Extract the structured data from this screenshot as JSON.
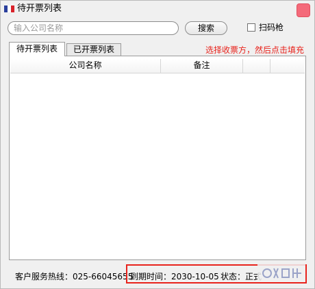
{
  "window": {
    "title": "待开票列表"
  },
  "search": {
    "placeholder": "输入公司名称",
    "value": "",
    "button_label": "搜索"
  },
  "scan": {
    "label": "扫码枪",
    "checked": false
  },
  "tabs": [
    {
      "label": "待开票列表",
      "active": true
    },
    {
      "label": "已开票列表",
      "active": false
    }
  ],
  "hint": "选择收票方，然后点击填充",
  "table": {
    "columns": [
      "公司名称",
      "备注",
      "",
      ""
    ],
    "rows": []
  },
  "footer": {
    "hotline_label": "客户服务热线：",
    "hotline_number": "025-66045655",
    "expiry_label": "到期时间：",
    "expiry_date": "2030-10-05",
    "status_label": "状态：",
    "status_value": "正式"
  },
  "colors": {
    "accent_red": "#e8231c",
    "close_button": "#f46a7a"
  }
}
